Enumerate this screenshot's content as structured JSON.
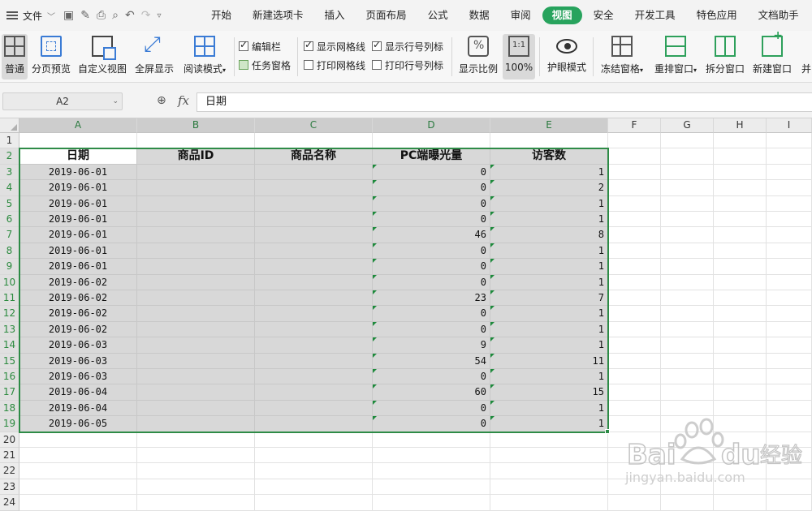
{
  "menubar": {
    "file_label": "文件",
    "tabs": [
      "开始",
      "新建选项卡",
      "插入",
      "页面布局",
      "公式",
      "数据",
      "审阅",
      "视图",
      "安全",
      "开发工具",
      "特色应用",
      "文档助手"
    ],
    "active_tab": "视图"
  },
  "ribbon": {
    "normal": "普通",
    "page_break": "分页预览",
    "custom_view": "自定义视图",
    "full_screen": "全屏显示",
    "reading_mode": "阅读模式",
    "checkboxes": {
      "edit_bar": "编辑栏",
      "task_pane": "任务窗格",
      "show_gridlines": "显示网格线",
      "print_gridlines": "打印网格线",
      "show_row_col_headers": "显示行号列标",
      "print_row_col_headers": "打印行号列标"
    },
    "zoom_ratio": "显示比例",
    "zoom_100": "100%",
    "eye_mode": "护眼模式",
    "freeze_panes": "冻结窗格",
    "rearrange": "重排窗口",
    "split_window": "拆分窗口",
    "new_window": "新建窗口",
    "overflow": "并"
  },
  "formula_bar": {
    "name_box": "A2",
    "fx": "fx",
    "value": "日期"
  },
  "sheet": {
    "columns": [
      "A",
      "B",
      "C",
      "D",
      "E",
      "F",
      "G",
      "H",
      "I"
    ],
    "rows": [
      "1",
      "2",
      "3",
      "4",
      "5",
      "6",
      "7",
      "8",
      "9",
      "10",
      "11",
      "12",
      "13",
      "14",
      "15",
      "16",
      "17",
      "18",
      "19",
      "20",
      "21",
      "22",
      "23",
      "24"
    ],
    "headers": [
      "日期",
      "商品ID",
      "商品名称",
      "PC端曝光量",
      "访客数"
    ],
    "data": [
      [
        "2019-06-01",
        "",
        "",
        "0",
        "1"
      ],
      [
        "2019-06-01",
        "",
        "",
        "0",
        "2"
      ],
      [
        "2019-06-01",
        "",
        "",
        "0",
        "1"
      ],
      [
        "2019-06-01",
        "",
        "",
        "0",
        "1"
      ],
      [
        "2019-06-01",
        "",
        "",
        "46",
        "8"
      ],
      [
        "2019-06-01",
        "",
        "",
        "0",
        "1"
      ],
      [
        "2019-06-01",
        "",
        "",
        "0",
        "1"
      ],
      [
        "2019-06-02",
        "",
        "",
        "0",
        "1"
      ],
      [
        "2019-06-02",
        "",
        "",
        "23",
        "7"
      ],
      [
        "2019-06-02",
        "",
        "",
        "0",
        "1"
      ],
      [
        "2019-06-02",
        "",
        "",
        "0",
        "1"
      ],
      [
        "2019-06-03",
        "",
        "",
        "9",
        "1"
      ],
      [
        "2019-06-03",
        "",
        "",
        "54",
        "11"
      ],
      [
        "2019-06-03",
        "",
        "",
        "0",
        "1"
      ],
      [
        "2019-06-04",
        "",
        "",
        "60",
        "15"
      ],
      [
        "2019-06-04",
        "",
        "",
        "0",
        "1"
      ],
      [
        "2019-06-05",
        "",
        "",
        "0",
        "1"
      ]
    ]
  },
  "watermark": {
    "brand": "Bai du 经验",
    "url": "jingyan.baidu.com"
  },
  "colors": {
    "accent": "#27a35d",
    "selection_border": "#2e8b47",
    "selection_fill": "#d8d8d8"
  }
}
